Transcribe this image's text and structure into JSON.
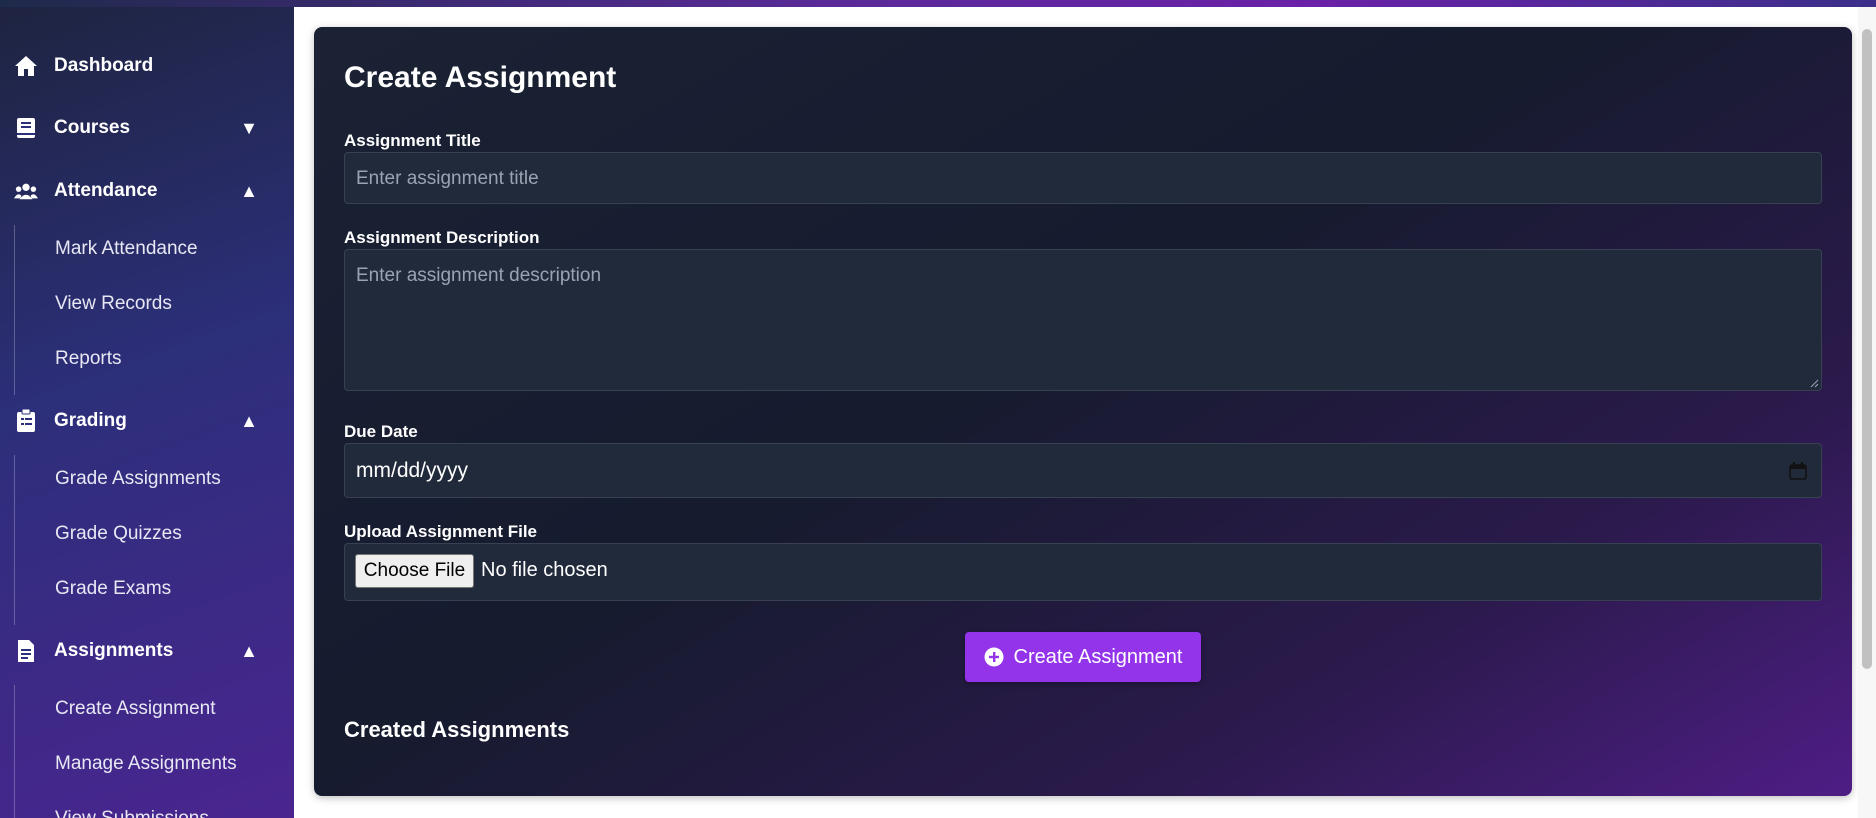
{
  "sidebar": {
    "items": [
      {
        "label": "Dashboard",
        "icon": "home-icon"
      },
      {
        "label": "Courses",
        "icon": "book-icon",
        "caret": "chevron-down-icon"
      },
      {
        "label": "Attendance",
        "icon": "users-icon",
        "caret": "chevron-up-icon",
        "sub": [
          "Mark Attendance",
          "View Records",
          "Reports"
        ]
      },
      {
        "label": "Grading",
        "icon": "clipboard-icon",
        "caret": "chevron-up-icon",
        "sub": [
          "Grade Assignments",
          "Grade Quizzes",
          "Grade Exams"
        ]
      },
      {
        "label": "Assignments",
        "icon": "file-icon",
        "caret": "chevron-up-icon",
        "sub": [
          "Create Assignment",
          "Manage Assignments",
          "View Submissions"
        ]
      }
    ]
  },
  "form": {
    "title": "Create Assignment",
    "assignment_title": {
      "label": "Assignment Title",
      "placeholder": "Enter assignment title"
    },
    "assignment_description": {
      "label": "Assignment Description",
      "placeholder": "Enter assignment description"
    },
    "due_date": {
      "label": "Due Date",
      "value": "mm/dd/yyyy"
    },
    "upload": {
      "label": "Upload Assignment File",
      "button": "Choose File",
      "status": "No file chosen"
    },
    "submit_label": "Create Assignment",
    "created_title": "Created Assignments"
  },
  "colors": {
    "accent": "#9333ea",
    "card_bg": "#1a2234",
    "sidebar_bg": "#2c2f7a"
  }
}
